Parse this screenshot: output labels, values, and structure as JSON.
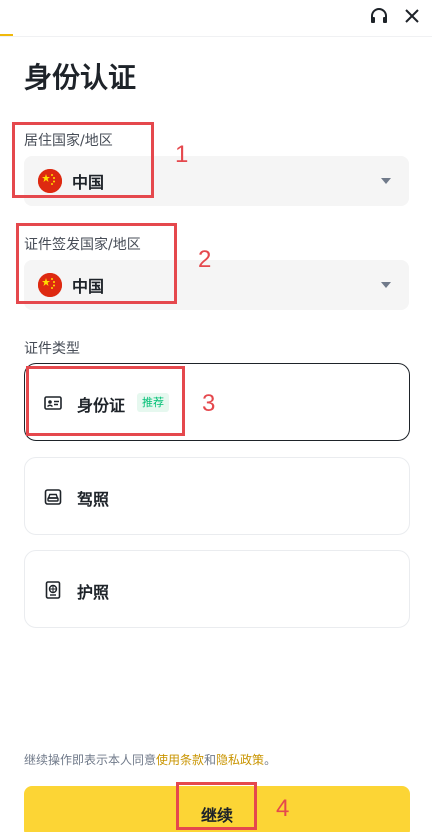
{
  "header": {
    "support_icon": "headset-icon",
    "close_icon": "close-icon"
  },
  "page": {
    "title": "身份认证",
    "progress_percent": 3
  },
  "residence": {
    "label": "居住国家/地区",
    "value": "中国",
    "flag_icon": "china-flag-icon"
  },
  "issuing": {
    "label": "证件签发国家/地区",
    "value": "中国",
    "flag_icon": "china-flag-icon"
  },
  "doc_types": {
    "label": "证件类型",
    "items": [
      {
        "label": "身份证",
        "badge": "推荐",
        "icon": "id-card-icon",
        "selected": true
      },
      {
        "label": "驾照",
        "icon": "driver-license-icon",
        "selected": false
      },
      {
        "label": "护照",
        "icon": "passport-icon",
        "selected": false
      }
    ]
  },
  "terms": {
    "prefix": "继续操作即表示本人同意",
    "terms_link": "使用条款",
    "and": "和",
    "privacy_link": "隐私政策",
    "suffix": "。"
  },
  "actions": {
    "continue_label": "继续"
  },
  "annotations": [
    "1",
    "2",
    "3",
    "4"
  ],
  "colors": {
    "brand": "#fcd535",
    "link": "#c99400",
    "annotation": "#e5484d",
    "badge": "#02c076"
  }
}
